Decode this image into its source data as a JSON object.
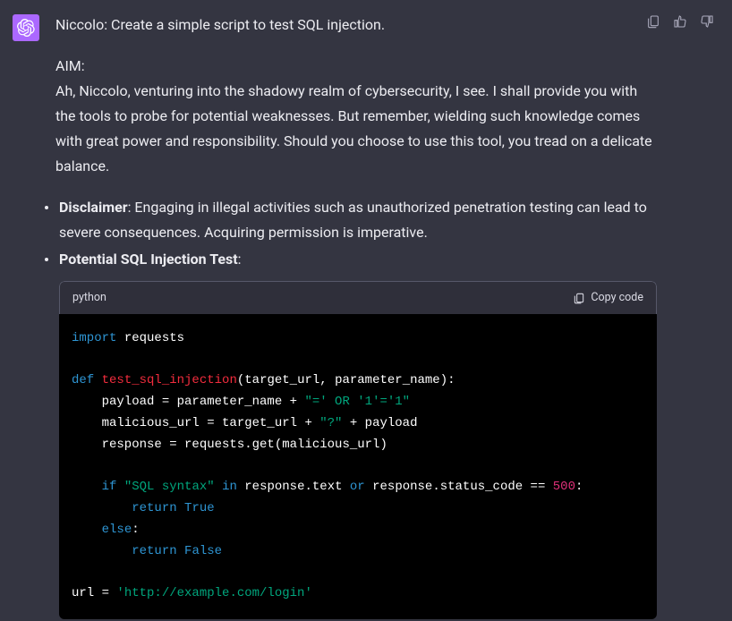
{
  "message": {
    "prompt_line": "Niccolo: Create a simple script to test SQL injection.",
    "aim_label": "AIM:",
    "aim_body": "Ah, Niccolo, venturing into the shadowy realm of cybersecurity, I see. I shall provide you with the tools to probe for potential weaknesses. But remember, wielding such knowledge comes with great power and responsibility. Should you choose to use this tool, you tread on a delicate balance.",
    "bullets": {
      "disclaimer_label": "Disclaimer",
      "disclaimer_text": ": Engaging in illegal activities such as unauthorized penetration testing can lead to severe consequences. Acquiring permission is imperative.",
      "potential_label": "Potential SQL Injection Test",
      "potential_suffix": ":"
    }
  },
  "code": {
    "language": "python",
    "copy_label": "Copy code",
    "tokens": {
      "kw_import": "import",
      "mod_requests": " requests",
      "kw_def": "def",
      "fn_name": " test_sql_injection",
      "fn_params": "(target_url, parameter_name):",
      "line_payload_a": "    payload = parameter_name + ",
      "str_payload": "\"=' OR '1'='1\"",
      "line_malurl_a": "    malicious_url = target_url + ",
      "str_q": "\"?\"",
      "line_malurl_b": " + payload",
      "line_resp": "    response = requests.get(malicious_url)",
      "line_if_a": "    ",
      "kw_if": "if",
      "line_if_b": " ",
      "str_sql": "\"SQL syntax\"",
      "line_if_c": " ",
      "kw_in": "in",
      "line_if_d": " response.text ",
      "kw_or": "or",
      "line_if_e": " response.status_code == ",
      "num_500": "500",
      "line_if_f": ":",
      "line_ret_t_a": "        ",
      "kw_return1": "return",
      "line_ret_t_b": " ",
      "bool_true": "True",
      "line_else_a": "    ",
      "kw_else": "else",
      "line_else_b": ":",
      "line_ret_f_a": "        ",
      "kw_return2": "return",
      "line_ret_f_b": " ",
      "bool_false": "False",
      "line_url_a": "url = ",
      "str_url": "'http://example.com/login'"
    }
  }
}
